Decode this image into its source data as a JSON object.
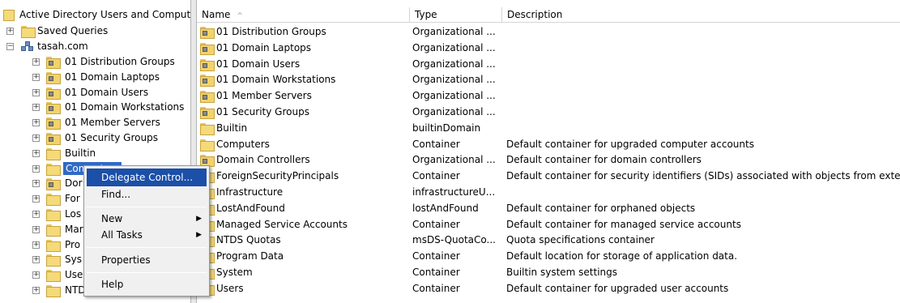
{
  "tree": {
    "root_label": "Active Directory Users and Comput",
    "saved_queries": "Saved Queries",
    "domain": "tasah.com",
    "nodes": [
      {
        "label": "01 Distribution Groups",
        "ou": true
      },
      {
        "label": "01 Domain Laptops",
        "ou": true
      },
      {
        "label": "01 Domain Users",
        "ou": true
      },
      {
        "label": "01 Domain Workstations",
        "ou": true
      },
      {
        "label": "01 Member Servers",
        "ou": true
      },
      {
        "label": "01 Security Groups",
        "ou": true
      },
      {
        "label": "Builtin",
        "ou": false
      },
      {
        "label": "Computers",
        "ou": false
      },
      {
        "label": "Dor",
        "ou": true
      },
      {
        "label": "For",
        "ou": false
      },
      {
        "label": "Los",
        "ou": false
      },
      {
        "label": "Mar",
        "ou": false
      },
      {
        "label": "Pro",
        "ou": false
      },
      {
        "label": "Sys",
        "ou": false
      },
      {
        "label": "Use",
        "ou": false
      },
      {
        "label": "NTD",
        "ou": false
      }
    ]
  },
  "list": {
    "columns": [
      "Name",
      "Type",
      "Description"
    ],
    "sort_indicator": "^",
    "rows": [
      {
        "name": "01 Distribution Groups",
        "type": "Organizational ...",
        "description": "",
        "ou": true
      },
      {
        "name": "01 Domain Laptops",
        "type": "Organizational ...",
        "description": "",
        "ou": true
      },
      {
        "name": "01 Domain Users",
        "type": "Organizational ...",
        "description": "",
        "ou": true
      },
      {
        "name": "01 Domain Workstations",
        "type": "Organizational ...",
        "description": "",
        "ou": true
      },
      {
        "name": "01 Member Servers",
        "type": "Organizational ...",
        "description": "",
        "ou": true
      },
      {
        "name": "01 Security Groups",
        "type": "Organizational ...",
        "description": "",
        "ou": true
      },
      {
        "name": "Builtin",
        "type": "builtinDomain",
        "description": "",
        "ou": false
      },
      {
        "name": "Computers",
        "type": "Container",
        "description": "Default container for upgraded computer accounts",
        "ou": false
      },
      {
        "name": "Domain Controllers",
        "type": "Organizational ...",
        "description": "Default container for domain controllers",
        "ou": true
      },
      {
        "name": "ForeignSecurityPrincipals",
        "type": "Container",
        "description": "Default container for security identifiers (SIDs) associated with objects from external",
        "ou": false
      },
      {
        "name": "Infrastructure",
        "type": "infrastructureU...",
        "description": "",
        "ou": false
      },
      {
        "name": "LostAndFound",
        "type": "lostAndFound",
        "description": "Default container for orphaned objects",
        "ou": false
      },
      {
        "name": "Managed Service Accounts",
        "type": "Container",
        "description": "Default container for managed service accounts",
        "ou": false
      },
      {
        "name": "NTDS Quotas",
        "type": "msDS-QuotaCo...",
        "description": "Quota specifications container",
        "ou": false
      },
      {
        "name": "Program Data",
        "type": "Container",
        "description": "Default location for storage of application data.",
        "ou": false
      },
      {
        "name": "System",
        "type": "Container",
        "description": "Builtin system settings",
        "ou": false
      },
      {
        "name": "Users",
        "type": "Container",
        "description": "Default container for upgraded user accounts",
        "ou": false
      }
    ]
  },
  "context_menu": {
    "delegate_control": "Delegate Control...",
    "find": "Find...",
    "new": "New",
    "all_tasks": "All Tasks",
    "properties": "Properties",
    "help": "Help",
    "submenu_arrow": "▶"
  },
  "icons": {
    "expand": "+",
    "collapse": "−"
  },
  "colors": {
    "selection": "#316ac5",
    "menu_highlight": "#1b4fa8",
    "folder": "#f5da7a"
  }
}
